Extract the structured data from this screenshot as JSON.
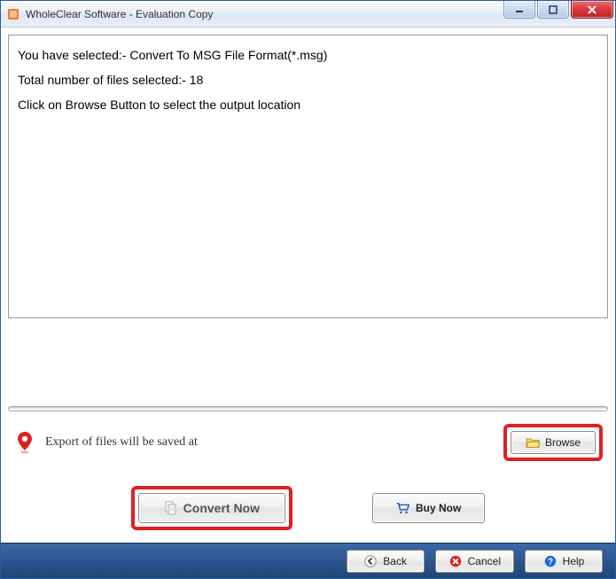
{
  "window": {
    "title": "WholeClear Software - Evaluation Copy"
  },
  "log": {
    "line1": "You have selected:- Convert To MSG File Format(*.msg)",
    "line2": "Total number of files selected:- 18",
    "line3": "Click on Browse Button to select the output location"
  },
  "export": {
    "label": "Export of files will be saved at",
    "browse_label": "Browse"
  },
  "actions": {
    "convert_label": "Convert Now",
    "buy_label": "Buy Now"
  },
  "footer": {
    "back_label": "Back",
    "cancel_label": "Cancel",
    "help_label": "Help"
  }
}
